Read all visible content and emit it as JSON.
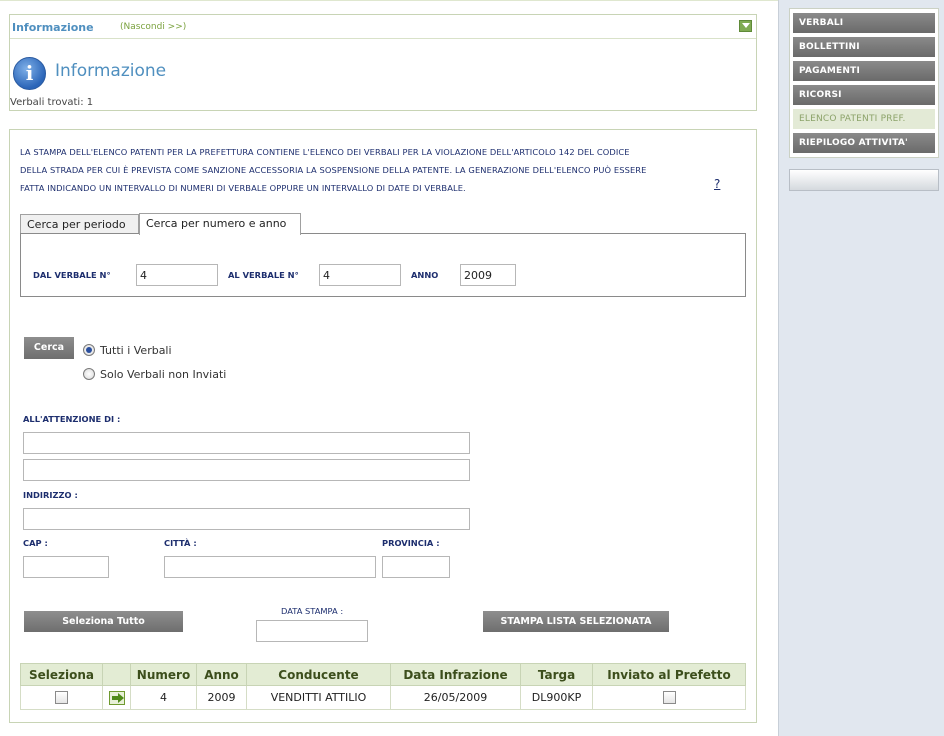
{
  "sidebar": {
    "items": [
      {
        "label": "VERBALI"
      },
      {
        "label": "BOLLETTINI"
      },
      {
        "label": "PAGAMENTI"
      },
      {
        "label": "RICORSI"
      },
      {
        "label": "ELENCO PATENTI PREF."
      },
      {
        "label": "RIEPILOGO ATTIVITA'"
      }
    ],
    "active_index": 4
  },
  "info": {
    "title": "Informazione",
    "hide_link": "(Nascondi >>)",
    "heading": "Informazione",
    "icon_glyph": "i",
    "count_text": "Verbali trovati: 1"
  },
  "description": {
    "line1": "LA STAMPA DELL'ELENCO PATENTI PER LA PREFETTURA CONTIENE L'ELENCO DEI VERBALI PER LA VIOLAZIONE DELL'ARTICOLO 142 DEL CODICE",
    "line2": "DELLA STRADA PER CUI È PREVISTA COME SANZIONE ACCESSORIA LA SOSPENSIONE DELLA PATENTE. LA GENERAZIONE DELL'ELENCO PUÒ ESSERE",
    "line3": "FATTA INDICANDO UN INTERVALLO DI NUMERI DI VERBALE OPPURE UN INTERVALLO DI DATE DI VERBALE.",
    "help": "?"
  },
  "tabs": [
    {
      "label": "Cerca per periodo"
    },
    {
      "label": "Cerca per numero e anno"
    }
  ],
  "search": {
    "from_label": "DAL VERBALE N°",
    "from_value": "4",
    "to_label": "AL VERBALE N°",
    "to_value": "4",
    "year_label": "ANNO",
    "year_value": "2009",
    "button": "Cerca",
    "radio_all": "Tutti i Verbali",
    "radio_not_sent": "Solo Verbali non Inviati"
  },
  "address": {
    "attention_label": "ALL'ATTENZIONE DI :",
    "address_label": "INDIRIZZO :",
    "cap_label": "CAP :",
    "city_label": "CITTÀ :",
    "province_label": "PROVINCIA :"
  },
  "actions": {
    "select_all": "Seleziona Tutto",
    "print_date_label": "DATA STAMPA :",
    "print_selected": "STAMPA LISTA SELEZIONATA"
  },
  "table": {
    "headers": [
      "Seleziona",
      "",
      "Numero",
      "Anno",
      "Conducente",
      "Data Infrazione",
      "Targa",
      "Inviato al Prefetto"
    ],
    "rows": [
      {
        "numero": "4",
        "anno": "2009",
        "conducente": "VENDITTI ATTILIO",
        "data": "26/05/2009",
        "targa": "DL900KP"
      }
    ]
  },
  "colors": {
    "accent_blue": "#4f8fbf",
    "accent_green": "#7ba23f",
    "header_bg": "#e3ecd4"
  }
}
